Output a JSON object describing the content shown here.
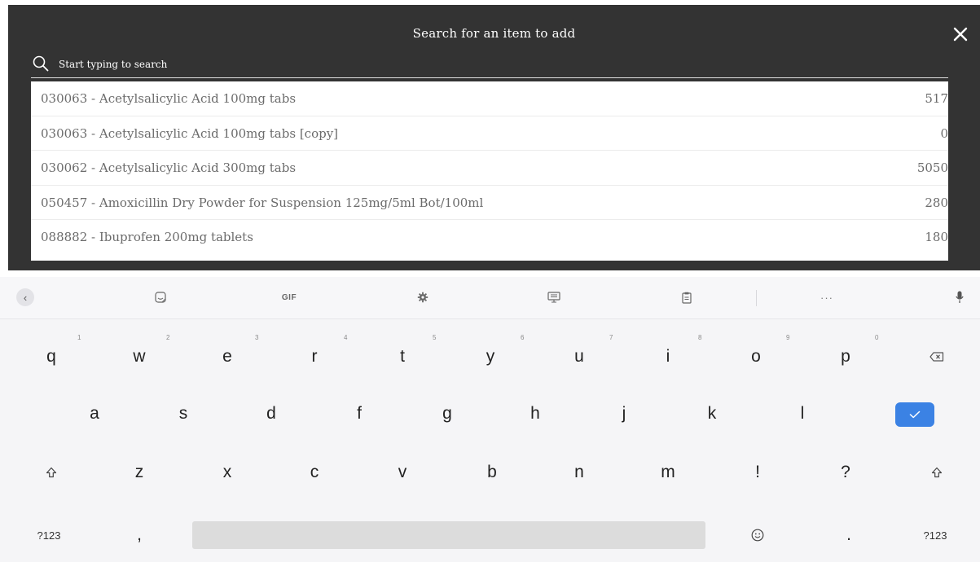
{
  "modal": {
    "title": "Search for an item to add",
    "search": {
      "placeholder": "Start typing to search",
      "value": ""
    },
    "results": [
      {
        "name": "030063 - Acetylsalicylic Acid 100mg tabs",
        "qty": "517"
      },
      {
        "name": "030063 - Acetylsalicylic Acid 100mg tabs [copy]",
        "qty": "0"
      },
      {
        "name": "030062 - Acetylsalicylic Acid 300mg tabs",
        "qty": "5050"
      },
      {
        "name": "050457 - Amoxicillin Dry Powder for Suspension 125mg/5ml Bot/100ml",
        "qty": "280"
      },
      {
        "name": "088882 - Ibuprofen 200mg tablets",
        "qty": "180"
      }
    ]
  },
  "keyboard": {
    "toolbar": {
      "gif_label": "GIF",
      "more_label": "···",
      "icons": [
        "back-icon",
        "sticker-icon",
        "settings-icon",
        "theme-icon",
        "clipboard-icon",
        "microphone-icon"
      ]
    },
    "row1": {
      "keys": [
        "q",
        "w",
        "e",
        "r",
        "t",
        "y",
        "u",
        "i",
        "o",
        "p"
      ],
      "hints": [
        "1",
        "2",
        "3",
        "4",
        "5",
        "6",
        "7",
        "8",
        "9",
        "0"
      ]
    },
    "row2": {
      "keys": [
        "a",
        "s",
        "d",
        "f",
        "g",
        "h",
        "j",
        "k",
        "l"
      ]
    },
    "row3": {
      "keys": [
        "z",
        "x",
        "c",
        "v",
        "b",
        "n",
        "m",
        "!",
        "?"
      ]
    },
    "row4": {
      "symbols_left": "?123",
      "comma": ",",
      "period": ".",
      "symbols_right": "?123"
    },
    "accent_color": "#3b82e4"
  }
}
